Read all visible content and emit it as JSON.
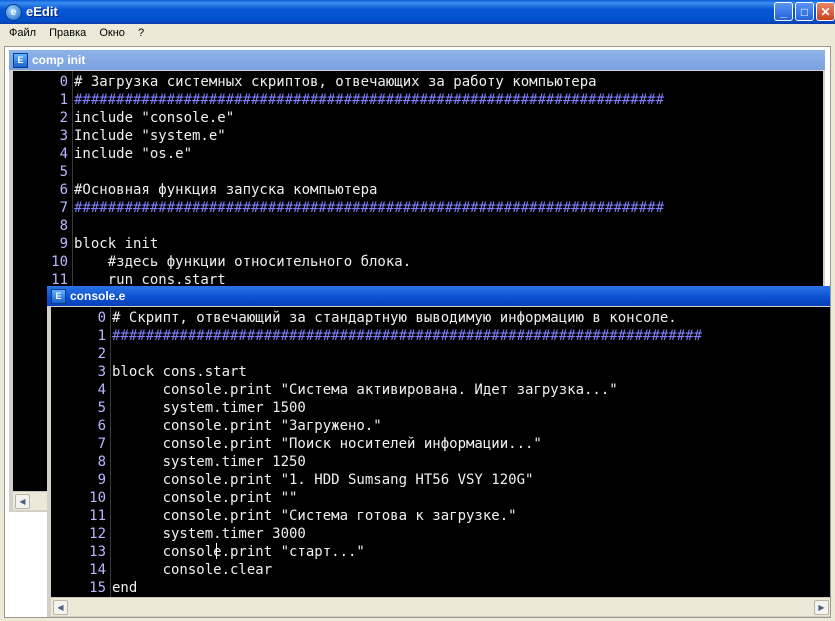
{
  "app": {
    "title": "eEdit",
    "icon": "app-icon"
  },
  "window_buttons": {
    "minimize": "_",
    "maximize": "□",
    "close": "✕"
  },
  "menu": [
    "Файл",
    "Правка",
    "Окно",
    "?"
  ],
  "windows": {
    "comp_init": {
      "title": "comp init",
      "active": false,
      "lines": [
        {
          "n": "0",
          "text": "# Загрузка системных скриптов, отвечающих за работу компьютера"
        },
        {
          "n": "1",
          "text": "######################################################################"
        },
        {
          "n": "2",
          "text": "include \"console.e\""
        },
        {
          "n": "3",
          "text": "Include \"system.e\""
        },
        {
          "n": "4",
          "text": "include \"os.e\""
        },
        {
          "n": "5",
          "text": ""
        },
        {
          "n": "6",
          "text": "#Основная функция запуска компьютера"
        },
        {
          "n": "7",
          "text": "######################################################################"
        },
        {
          "n": "8",
          "text": ""
        },
        {
          "n": "9",
          "text": "block init"
        },
        {
          "n": "10",
          "text": "    #здесь функции относительного блока."
        },
        {
          "n": "11",
          "text": "    run cons.start"
        }
      ]
    },
    "console_e": {
      "title": "console.e",
      "active": true,
      "lines": [
        {
          "n": "0",
          "text": "# Скрипт, отвечающий за стандартную выводимую информацию в консоле."
        },
        {
          "n": "1",
          "text": "######################################################################"
        },
        {
          "n": "2",
          "text": ""
        },
        {
          "n": "3",
          "text": "block cons.start"
        },
        {
          "n": "4",
          "text": "      console.print \"Система активирована. Идет загрузка...\""
        },
        {
          "n": "5",
          "text": "      system.timer 1500"
        },
        {
          "n": "6",
          "text": "      console.print \"Загружено.\""
        },
        {
          "n": "7",
          "text": "      console.print \"Поиск носителей информации...\""
        },
        {
          "n": "8",
          "text": "      system.timer 1250"
        },
        {
          "n": "9",
          "text": "      console.print \"1. HDD Sumsang HT56 VSY 120G\""
        },
        {
          "n": "10",
          "text": "      console.print \"\""
        },
        {
          "n": "11",
          "text": "      console.print \"Система готова к загрузке.\""
        },
        {
          "n": "12",
          "text": "      system.timer 3000"
        },
        {
          "n": "13",
          "text": "      console.print \"старт...\""
        },
        {
          "n": "14",
          "text": "      console.clear"
        },
        {
          "n": "15",
          "text": "end"
        }
      ]
    }
  },
  "colors": {
    "editor_bg": "#000000",
    "line_numbers": "#b8b8ff",
    "code_text": "#f0f0f0",
    "hash_rule": "#8080ff",
    "titlebar_blue": "#0556d6"
  }
}
